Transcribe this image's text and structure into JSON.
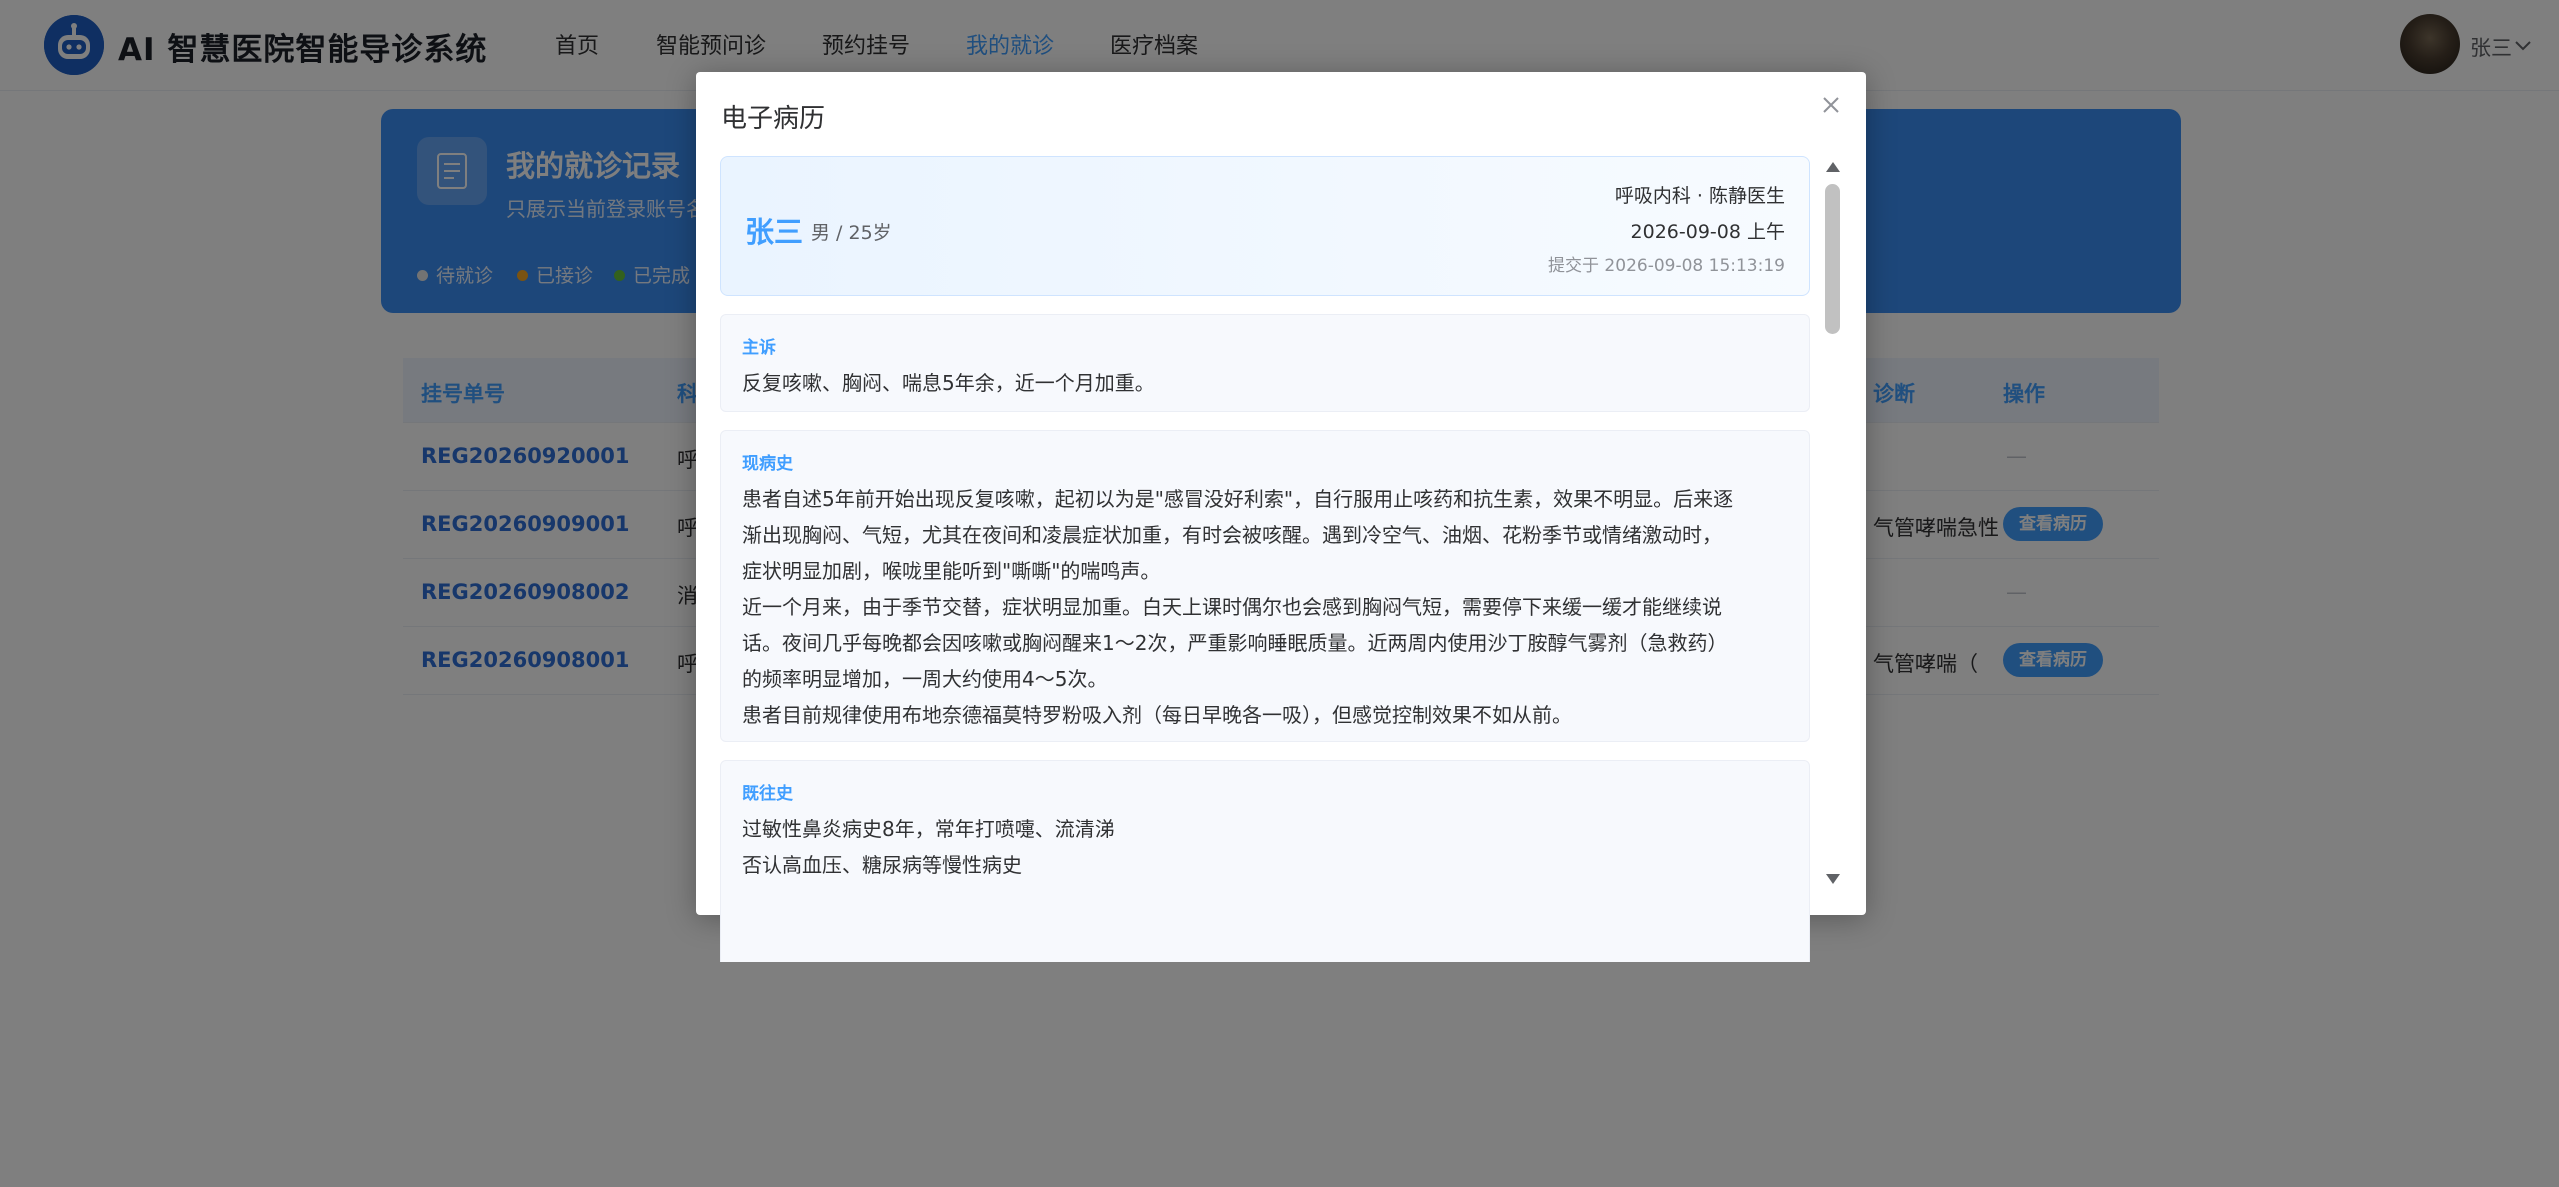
{
  "header": {
    "title": "AI 智慧医院智能导诊系统",
    "nav": [
      "首页",
      "智能预问诊",
      "预约挂号",
      "我的就诊",
      "医疗档案"
    ],
    "active_nav": "我的就诊",
    "user_name": "张三",
    "accent": "#409eff"
  },
  "banner": {
    "title": "我的就诊记录",
    "subtitle": "只展示当前登录账号名",
    "legend": [
      {
        "label": "待就诊",
        "color": "#e6e6e6"
      },
      {
        "label": "已接诊",
        "color": "#f5a623"
      },
      {
        "label": "已完成",
        "color": "#67c23a"
      }
    ]
  },
  "table": {
    "headers": {
      "id": "挂号单号",
      "dept": "科",
      "diagnosis": "诊断",
      "op": "操作"
    },
    "rows": [
      {
        "id": "REG20260920001",
        "dept": "呼",
        "diagnosis": "",
        "op": "—"
      },
      {
        "id": "REG20260909001",
        "dept": "呼",
        "diagnosis": "气管哮喘急性",
        "op": "查看病历"
      },
      {
        "id": "REG20260908002",
        "dept": "消",
        "diagnosis": "",
        "op": "—"
      },
      {
        "id": "REG20260908001",
        "dept": "呼",
        "diagnosis": "气管哮喘（",
        "op": "查看病历"
      }
    ]
  },
  "dialog": {
    "title": "电子病历",
    "patient": {
      "name": "张三",
      "meta": "男 / 25岁",
      "dept_doctor": "呼吸内科 · 陈静医生",
      "visit_date": "2026-09-08 上午",
      "submit_time": "提交于 2026-09-08 15:13:19"
    },
    "sections": [
      {
        "title": "主诉",
        "lines": [
          "反复咳嗽、胸闷、喘息5年余，近一个月加重。"
        ]
      },
      {
        "title": "现病史",
        "lines": [
          "患者自述5年前开始出现反复咳嗽，起初以为是\"感冒没好利索\"，自行服用止咳药和抗生素，效果不明显。后来逐",
          "渐出现胸闷、气短，尤其在夜间和凌晨症状加重，有时会被咳醒。遇到冷空气、油烟、花粉季节或情绪激动时，",
          "症状明显加剧，喉咙里能听到\"嘶嘶\"的喘鸣声。",
          "近一个月来，由于季节交替，症状明显加重。白天上课时偶尔也会感到胸闷气短，需要停下来缓一缓才能继续说",
          "话。夜间几乎每晚都会因咳嗽或胸闷醒来1～2次，严重影响睡眠质量。近两周内使用沙丁胺醇气雾剂（急救药）",
          "的频率明显增加，一周大约使用4～5次。",
          "患者目前规律使用布地奈德福莫特罗粉吸入剂（每日早晚各一吸），但感觉控制效果不如从前。"
        ]
      },
      {
        "title": "既往史",
        "lines": [
          "过敏性鼻炎病史8年，常年打喷嚏、流清涕",
          "否认高血压、糖尿病等慢性病史"
        ]
      }
    ]
  }
}
